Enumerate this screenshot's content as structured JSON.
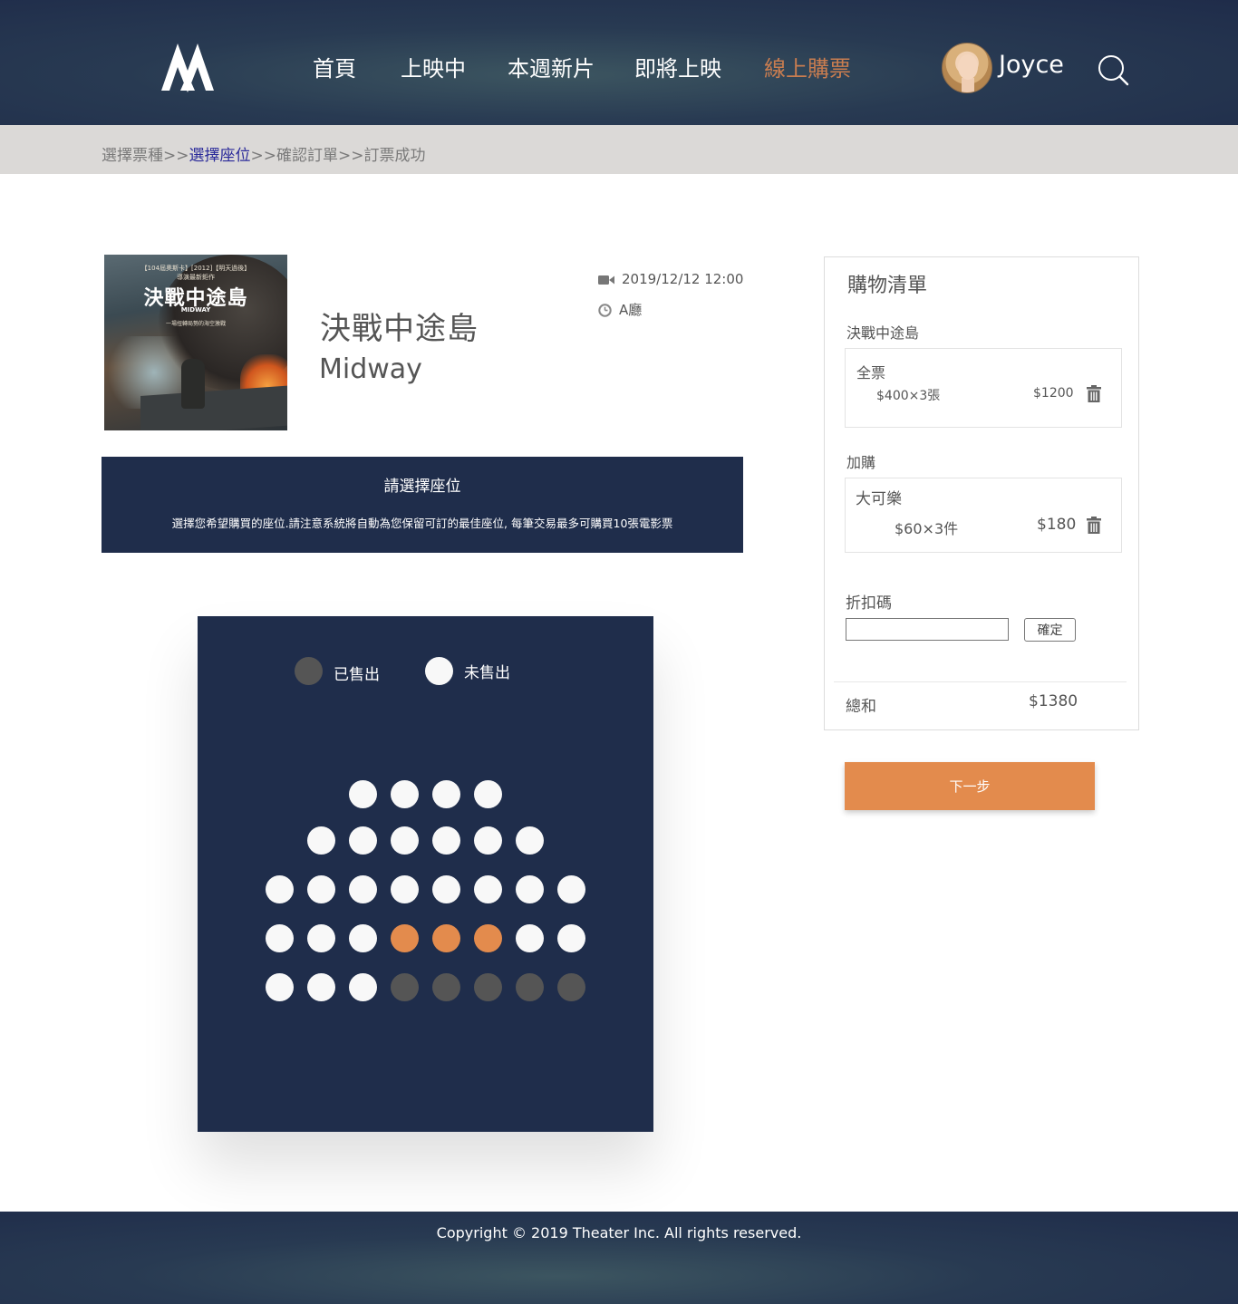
{
  "header": {
    "logo_icon": "logo-mountain-icon",
    "nav": [
      {
        "label": "首頁",
        "active": false
      },
      {
        "label": "上映中",
        "active": false
      },
      {
        "label": "本週新片",
        "active": false
      },
      {
        "label": "即將上映",
        "active": false
      },
      {
        "label": "線上購票",
        "active": true
      }
    ],
    "user_name": "Joyce",
    "search_icon": "search-icon"
  },
  "breadcrumb": {
    "steps": [
      "選擇票種",
      "選擇座位",
      "確認訂單",
      "訂票成功"
    ],
    "separator": ">>",
    "current_index": 1
  },
  "movie": {
    "poster": {
      "top_line": "【104屆奧斯卡】[2012]【明天過後】",
      "top_line2": "導演最新鉅作",
      "title": "決戰中途島",
      "subtitle": "MIDWAY",
      "tagline": "一場扭轉局勢的海空激戰"
    },
    "title_zh": "決戰中途島",
    "title_en": "Midway",
    "datetime": "2019/12/12 12:00",
    "hall": "A廳",
    "datetime_icon": "video-camera-icon",
    "hall_icon": "clock-icon"
  },
  "notice": {
    "heading": "請選擇座位",
    "description": "選擇您希望購買的座位.請注意系統將自動為您保留可訂的最佳座位, 每筆交易最多可購買10張電影票"
  },
  "seatmap": {
    "legend": [
      {
        "label": "已售出",
        "color": "#555555"
      },
      {
        "label": "未售出",
        "color": "#f8f8f8"
      }
    ],
    "colors": {
      "available": "#f8f8f8",
      "sold": "#555555",
      "selected": "#e38b4d"
    },
    "rows": [
      [
        "available",
        "available",
        "available",
        "available"
      ],
      [
        "available",
        "available",
        "available",
        "available",
        "available",
        "available"
      ],
      [
        "available",
        "available",
        "available",
        "available",
        "available",
        "available",
        "available",
        "available"
      ],
      [
        "available",
        "available",
        "available",
        "selected",
        "selected",
        "selected",
        "available",
        "available"
      ],
      [
        "available",
        "available",
        "available",
        "sold",
        "sold",
        "sold",
        "sold",
        "sold"
      ]
    ]
  },
  "cart": {
    "title": "購物清單",
    "movie_name": "決戰中途島",
    "ticket": {
      "type": "全票",
      "qty_text": "$400×3張",
      "subtotal": "$1200"
    },
    "addon_title": "加購",
    "addon": {
      "name": "大可樂",
      "qty_text": "$60×3件",
      "subtotal": "$180"
    },
    "promo_label": "折扣碼",
    "promo_value": "",
    "promo_button": "確定",
    "total_label": "總和",
    "total_value": "$1380",
    "trash_icon": "trash-icon"
  },
  "next_button": "下一步",
  "footer": {
    "copyright": "Copyright © 2019 Theater Inc. All rights reserved."
  },
  "colors": {
    "navy": "#1f2d4b",
    "accent_orange": "#e38b4d",
    "nav_active": "#c97d50"
  }
}
